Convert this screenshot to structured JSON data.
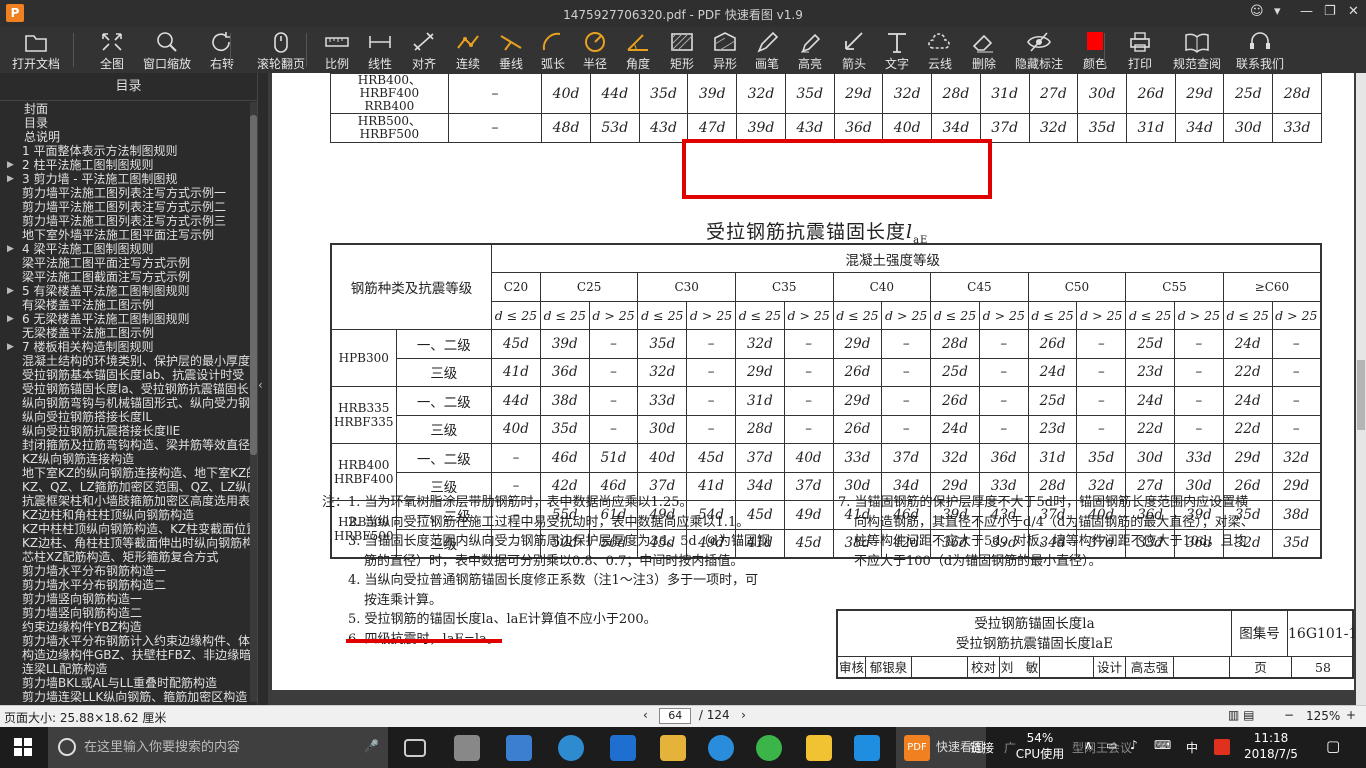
{
  "window": {
    "title": "1475927706320.pdf - PDF 快速看图 v1.9",
    "logo": "P"
  },
  "toolbar": [
    {
      "name": "open-file",
      "label": "打开文档",
      "icon": "folder-icon"
    },
    {
      "name": "fit-page",
      "label": "全图",
      "icon": "expand-icon"
    },
    {
      "name": "window-zoom",
      "label": "窗口缩放",
      "icon": "magnifier-icon"
    },
    {
      "name": "rotate",
      "label": "右转",
      "icon": "rotate-right-icon"
    },
    {
      "name": "scroll-page",
      "label": "滚轮翻页",
      "icon": "mouse-icon"
    },
    {
      "name": "scale",
      "label": "比例",
      "icon": "ruler-icon"
    },
    {
      "name": "linear",
      "label": "线性",
      "icon": "linear-dim-icon"
    },
    {
      "name": "aligned",
      "label": "对齐",
      "icon": "aligned-dim-icon"
    },
    {
      "name": "continuous",
      "label": "连续",
      "icon": "continuous-icon"
    },
    {
      "name": "perpendicular",
      "label": "垂线",
      "icon": "perpendicular-icon"
    },
    {
      "name": "arc-length",
      "label": "弧长",
      "icon": "arc-icon"
    },
    {
      "name": "radius",
      "label": "半径",
      "icon": "radius-icon"
    },
    {
      "name": "angle",
      "label": "角度",
      "icon": "angle-icon"
    },
    {
      "name": "rectangle",
      "label": "矩形",
      "icon": "rectangle-icon"
    },
    {
      "name": "irregular",
      "label": "异形",
      "icon": "irregular-icon"
    },
    {
      "name": "brush",
      "label": "画笔",
      "icon": "pen-icon"
    },
    {
      "name": "highlight",
      "label": "高亮",
      "icon": "highlighter-icon"
    },
    {
      "name": "arrow",
      "label": "箭头",
      "icon": "arrow-icon"
    },
    {
      "name": "text",
      "label": "文字",
      "icon": "text-icon"
    },
    {
      "name": "cloud-line",
      "label": "云线",
      "icon": "cloud-icon"
    },
    {
      "name": "delete",
      "label": "删除",
      "icon": "eraser-icon"
    },
    {
      "name": "hide-marks",
      "label": "隐藏标注",
      "icon": "eye-slash-icon"
    },
    {
      "name": "color",
      "label": "颜色",
      "icon": "color-swatch-icon"
    },
    {
      "name": "print",
      "label": "打印",
      "icon": "printer-icon"
    },
    {
      "name": "spec-lookup",
      "label": "规范查阅",
      "icon": "book-icon"
    },
    {
      "name": "contact",
      "label": "联系我们",
      "icon": "headset-icon"
    }
  ],
  "sidebar": {
    "header": "目录",
    "items": [
      {
        "label": "封面",
        "arrow": ""
      },
      {
        "label": "目录",
        "arrow": ""
      },
      {
        "label": "总说明",
        "arrow": ""
      },
      {
        "label": "1 平面整体表示方法制图规则",
        "arrow": ""
      },
      {
        "label": "2 柱平法施工图制图规则",
        "arrow": "▶"
      },
      {
        "label": "3 剪力墙 - 平法施工图制图规",
        "arrow": "▶"
      },
      {
        "label": "剪力墙平法施工图列表注写方式示例一",
        "arrow": ""
      },
      {
        "label": "剪力墙平法施工图列表注写方式示例二",
        "arrow": ""
      },
      {
        "label": "剪力墙平法施工图列表注写方式示例三",
        "arrow": ""
      },
      {
        "label": "地下室外墙平法施工图平面注写示例",
        "arrow": ""
      },
      {
        "label": "4 梁平法施工图制图规则",
        "arrow": "▶"
      },
      {
        "label": "梁平法施工图平面注写方式示例",
        "arrow": ""
      },
      {
        "label": "梁平法施工图截面注写方式示例",
        "arrow": ""
      },
      {
        "label": "5 有梁楼盖平法施工图制图规则",
        "arrow": "▶"
      },
      {
        "label": "有梁楼盖平法施工图示例",
        "arrow": ""
      },
      {
        "label": "6 无梁楼盖平法施工图制图规则",
        "arrow": "▶"
      },
      {
        "label": "无梁楼盖平法施工图示例",
        "arrow": ""
      },
      {
        "label": "7 楼板相关构造制图规则",
        "arrow": "▶"
      },
      {
        "label": "混凝土结构的环境类别、保护层的最小厚度",
        "arrow": ""
      },
      {
        "label": "受拉钢筋基本锚固长度lab、抗震设计时受",
        "arrow": ""
      },
      {
        "label": "受拉钢筋锚固长度la、受拉钢筋抗震锚固长",
        "arrow": ""
      },
      {
        "label": "纵向钢筋弯钩与机械锚固形式、纵向受力钢",
        "arrow": ""
      },
      {
        "label": "纵向受拉钢筋搭接长度lL",
        "arrow": ""
      },
      {
        "label": "纵向受拉钢筋抗震搭接长度llE",
        "arrow": ""
      },
      {
        "label": "封闭箍筋及拉筋弯钩构造、梁并筋等效直径",
        "arrow": ""
      },
      {
        "label": "KZ纵向钢筋连接构造",
        "arrow": ""
      },
      {
        "label": "地下室KZ的纵向钢筋连接构造、地下室KZ的",
        "arrow": ""
      },
      {
        "label": "KZ、QZ、LZ箍筋加密区范围、QZ、LZ纵向钢",
        "arrow": ""
      },
      {
        "label": "抗震框架柱和小墙肢箍筋加密区高度选用表",
        "arrow": ""
      },
      {
        "label": "KZ边柱和角柱柱顶纵向钢筋构造",
        "arrow": ""
      },
      {
        "label": "KZ中柱柱顶纵向钢筋构造、KZ柱变截面位置",
        "arrow": ""
      },
      {
        "label": "KZ边柱、角柱柱顶等截面伸出时纵向钢筋构",
        "arrow": ""
      },
      {
        "label": "芯柱XZ配筋构造、矩形箍筋复合方式",
        "arrow": ""
      },
      {
        "label": "剪力墙水平分布钢筋构造一",
        "arrow": ""
      },
      {
        "label": "剪力墙水平分布钢筋构造二",
        "arrow": ""
      },
      {
        "label": "剪力墙竖向钢筋构造一",
        "arrow": ""
      },
      {
        "label": "剪力墙竖向钢筋构造二",
        "arrow": ""
      },
      {
        "label": "约束边缘构件YBZ构造",
        "arrow": ""
      },
      {
        "label": "剪力墙水平分布钢筋计入约束边缘构件、体",
        "arrow": ""
      },
      {
        "label": "构造边缘构件GBZ、扶壁柱FBZ、非边缘暗柱",
        "arrow": ""
      },
      {
        "label": "连梁LL配筋构造",
        "arrow": ""
      },
      {
        "label": "剪力墙BKL或AL与LL重叠时配筋构造",
        "arrow": ""
      },
      {
        "label": "剪力墙连梁LLK纵向钢筋、箍筋加密区构造",
        "arrow": ""
      }
    ]
  },
  "doc": {
    "top_rows": [
      {
        "grade": "HRB400、HRBF400\nRRB400",
        "c20": "–",
        "vals": [
          "40d",
          "44d",
          "35d",
          "39d",
          "32d",
          "35d",
          "29d",
          "32d",
          "28d",
          "31d",
          "27d",
          "30d",
          "26d",
          "29d",
          "25d",
          "28d"
        ]
      },
      {
        "grade": "HRB500、HRBF500",
        "c20": "–",
        "vals": [
          "48d",
          "53d",
          "43d",
          "47d",
          "39d",
          "43d",
          "36d",
          "40d",
          "34d",
          "37d",
          "32d",
          "35d",
          "31d",
          "34d",
          "30d",
          "33d"
        ]
      }
    ],
    "caption": "受拉钢筋抗震锚固长度",
    "caption_sym": "l",
    "caption_sub": "aE",
    "conc_header": "混凝土强度等级",
    "rebar_header": "钢筋种类及抗震等级",
    "grades": [
      "C20",
      "C25",
      "C30",
      "C35",
      "C40",
      "C45",
      "C50",
      "C55",
      "≥C60"
    ],
    "d_le": "d ≤ 25",
    "d_gt": "d > 25",
    "rows": [
      {
        "type": "HPB300",
        "level": "一、二级",
        "c20": "45d",
        "vals": [
          "39d",
          "–",
          "35d",
          "–",
          "32d",
          "–",
          "29d",
          "–",
          "28d",
          "–",
          "26d",
          "–",
          "25d",
          "–",
          "24d",
          "–"
        ]
      },
      {
        "type": "",
        "level": "三级",
        "c20": "41d",
        "vals": [
          "36d",
          "–",
          "32d",
          "–",
          "29d",
          "–",
          "26d",
          "–",
          "25d",
          "–",
          "24d",
          "–",
          "23d",
          "–",
          "22d",
          "–"
        ]
      },
      {
        "type": "HRB335\nHRBF335",
        "level": "一、二级",
        "c20": "44d",
        "vals": [
          "38d",
          "–",
          "33d",
          "–",
          "31d",
          "–",
          "29d",
          "–",
          "26d",
          "–",
          "25d",
          "–",
          "24d",
          "–",
          "24d",
          "–"
        ]
      },
      {
        "type": "",
        "level": "三级",
        "c20": "40d",
        "vals": [
          "35d",
          "–",
          "30d",
          "–",
          "28d",
          "–",
          "26d",
          "–",
          "24d",
          "–",
          "23d",
          "–",
          "22d",
          "–",
          "22d",
          "–"
        ]
      },
      {
        "type": "HRB400\nHRBF400",
        "level": "一、二级",
        "c20": "–",
        "vals": [
          "46d",
          "51d",
          "40d",
          "45d",
          "37d",
          "40d",
          "33d",
          "37d",
          "32d",
          "36d",
          "31d",
          "35d",
          "30d",
          "33d",
          "29d",
          "32d"
        ]
      },
      {
        "type": "",
        "level": "三级",
        "c20": "–",
        "vals": [
          "42d",
          "46d",
          "37d",
          "41d",
          "34d",
          "37d",
          "30d",
          "34d",
          "29d",
          "33d",
          "28d",
          "32d",
          "27d",
          "30d",
          "26d",
          "29d"
        ]
      },
      {
        "type": "HRB500\nHRBF500",
        "level": "一、二级",
        "c20": "–",
        "vals": [
          "55d",
          "61d",
          "49d",
          "54d",
          "45d",
          "49d",
          "41d",
          "46d",
          "39d",
          "43d",
          "37d",
          "40d",
          "36d",
          "39d",
          "35d",
          "38d"
        ]
      },
      {
        "type": "",
        "level": "三级",
        "c20": "–",
        "vals": [
          "50d",
          "56d",
          "45d",
          "49d",
          "41d",
          "45d",
          "38d",
          "42d",
          "36d",
          "39d",
          "34d",
          "37d",
          "33d",
          "36d",
          "32d",
          "35d"
        ]
      }
    ],
    "notes_left": [
      "注：1. 当为环氧树脂涂层带肋钢筋时，表中数据尚应乘以1.25。",
      "2. 当纵向受拉钢筋在施工过程中易受扰动时，表中数据尚应乘以1.1。",
      "3. 当锚固长度范围内纵向受力钢筋周边保护层厚度为3d、5d（d为锚固钢",
      "筋的直径）时，表中数据可分别乘以0.8、0.7；中间时按内插值。",
      "4. 当纵向受拉普通钢筋锚固长度修正系数（注1～注3）多于一项时，可",
      "按连乘计算。",
      "5. 受拉钢筋的锚固长度la、laE计算值不应小于200。",
      "6. 四级抗震时，laE=la。"
    ],
    "notes_right": [
      "7. 当锚固钢筋的保护层厚度不大于5d时，锚固钢筋长度范围内应设置横",
      "向构造钢筋，其直径不应小于d/4（d为锚固钢筋的最大直径）；对梁、",
      "柱等构件间距不应大于5d，对板、墙等构件间距不应大于10d，且均",
      "不应大于100（d为锚固钢筋的最小直径）。"
    ],
    "titleblock": {
      "title1": "受拉钢筋锚固长度la",
      "title2": "受拉钢筋抗震锚固长度laE",
      "atlas_label": "图集号",
      "atlas_no": "16G101-1",
      "row2": [
        "审核",
        "郁银泉",
        "",
        "校对",
        "刘　敏",
        "",
        "设计",
        "高志强",
        "",
        "页",
        "58"
      ]
    }
  },
  "status": {
    "page_size": "页面大小: 25.88×18.62 厘米",
    "page": "64",
    "total": "/ 124",
    "zoom": "125%"
  },
  "taskbar": {
    "search_placeholder": "在这里输入你要搜索的内容",
    "cpu_pct": "54%",
    "cpu_label": "CPU使用",
    "time": "11:18",
    "date": "2018/7/5",
    "lang": "中",
    "link": "链接",
    "partial1": "快速看图",
    "partial2": "广",
    "partial3": "型网王会议"
  },
  "colors": {
    "accent": "#e00000",
    "app_orange": "#f08020"
  }
}
